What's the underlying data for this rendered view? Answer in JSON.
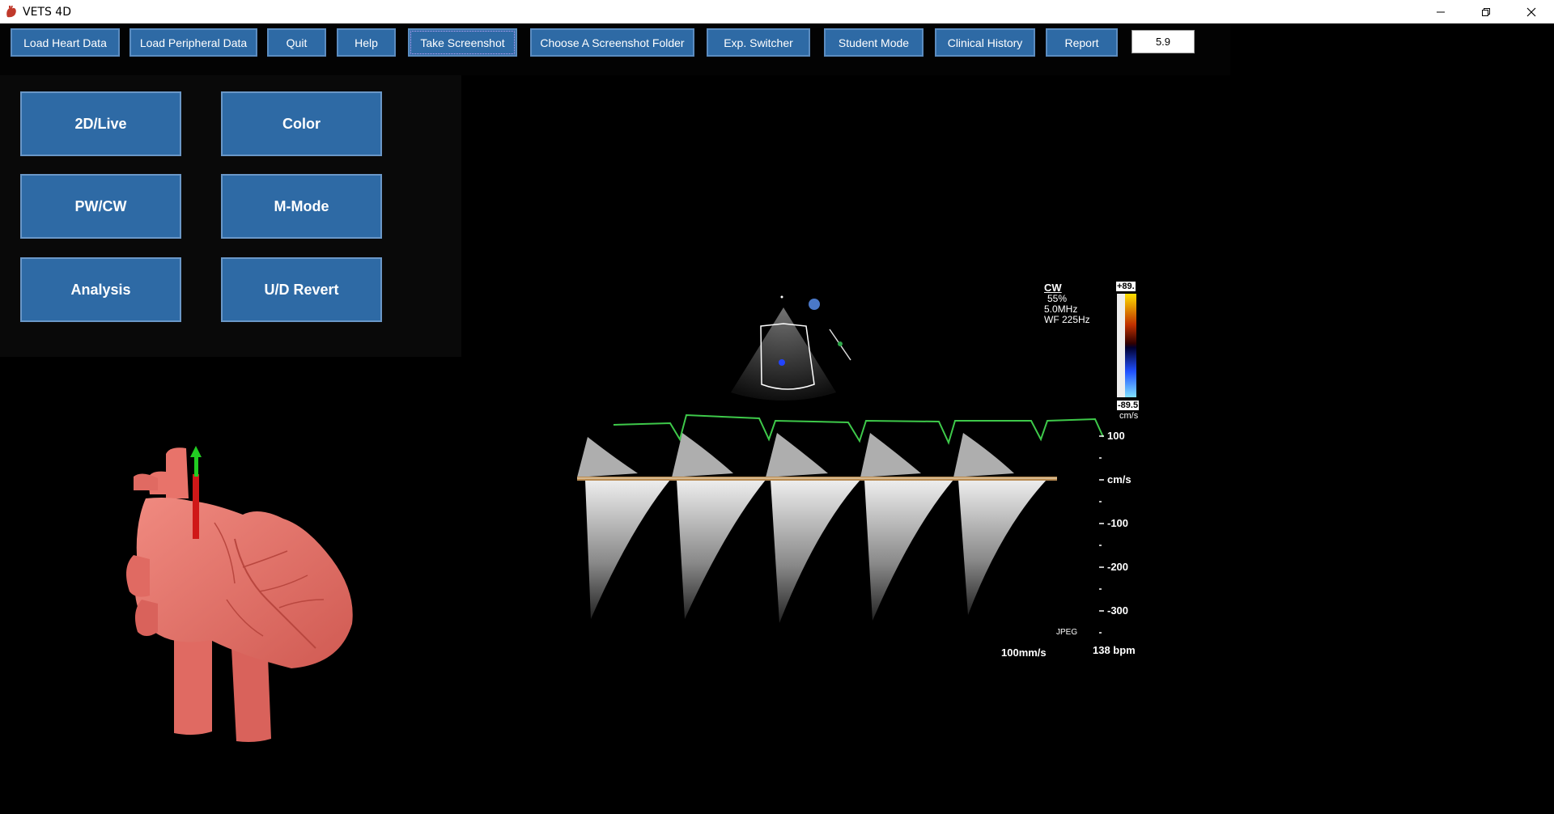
{
  "window": {
    "title": "VETS 4D"
  },
  "toolbar": {
    "buttons": [
      {
        "label": "Load Heart Data"
      },
      {
        "label": "Load Peripheral Data"
      },
      {
        "label": "Quit"
      },
      {
        "label": "Help"
      },
      {
        "label": "Take Screenshot"
      },
      {
        "label": "Choose A Screenshot Folder"
      },
      {
        "label": "Exp. Switcher"
      },
      {
        "label": "Student Mode"
      },
      {
        "label": "Clinical History"
      },
      {
        "label": "Report"
      }
    ],
    "version": "5.9"
  },
  "modes": {
    "buttons": [
      {
        "label": "2D/Live"
      },
      {
        "label": "Color"
      },
      {
        "label": "PW/CW"
      },
      {
        "label": "M-Mode"
      },
      {
        "label": "Analysis"
      },
      {
        "label": "U/D Revert"
      }
    ]
  },
  "ultrasound": {
    "mode": "CW",
    "power": "55%",
    "frequency": "5.0MHz",
    "wall_filter": "WF 225Hz",
    "scale_top": "+89.",
    "scale_bottom": "-89.5",
    "scale_unit": "cm/s",
    "axis_labels": [
      "100",
      "cm/s",
      "-100",
      "-200",
      "-300"
    ],
    "format": "JPEG",
    "sweep_speed": "100mm/s",
    "heart_rate": "138 bpm"
  },
  "colors": {
    "button_bg": "#2e6aa5",
    "heart": "#e8736a",
    "ecg": "#3ec94a",
    "vector_green": "#22cc22",
    "vector_red": "#d01818"
  }
}
